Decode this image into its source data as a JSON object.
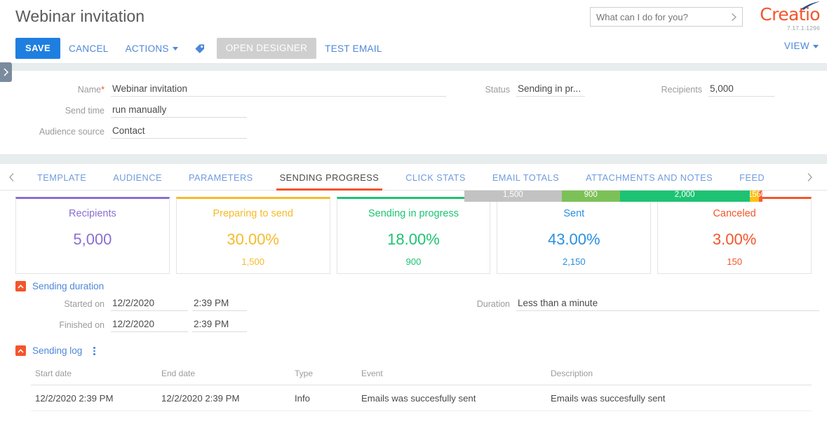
{
  "header": {
    "title": "Webinar invitation",
    "buttons": {
      "save": "SAVE",
      "cancel": "CANCEL",
      "actions": "ACTIONS",
      "tag_icon": "tag-icon",
      "open_designer": "OPEN DESIGNER",
      "test_email": "TEST EMAIL"
    },
    "search": {
      "placeholder": "What can I do for you?",
      "value": ""
    },
    "logo": {
      "name": "Creatio",
      "version": "7.17.1.1296"
    },
    "view": "VIEW"
  },
  "profile": {
    "fields_left": [
      {
        "label": "Name",
        "required": true,
        "value": "Webinar invitation"
      },
      {
        "label": "Send time",
        "required": false,
        "value": "run manually"
      },
      {
        "label": "Audience source",
        "required": false,
        "value": "Contact"
      }
    ],
    "fields_right": [
      {
        "label": "Status",
        "value": "Sending in pr..."
      },
      {
        "label": "Recipients",
        "value": "5,000"
      }
    ]
  },
  "progress_bar": {
    "segments": [
      {
        "label": "1,500",
        "value": 1500,
        "color": "#c2c2c2"
      },
      {
        "label": "900",
        "value": 900,
        "color": "#7cc157"
      },
      {
        "label": "2,000",
        "value": 2000,
        "color": "#1dc373"
      },
      {
        "label": "150",
        "value": 150,
        "color": "#ffc20e"
      },
      {
        "label": "50",
        "value": 50,
        "color": "#fb5a3c"
      }
    ],
    "total": 5000
  },
  "tabs": {
    "items": [
      {
        "label": "TEMPLATE",
        "active": false
      },
      {
        "label": "AUDIENCE",
        "active": false
      },
      {
        "label": "PARAMETERS",
        "active": false
      },
      {
        "label": "SENDING PROGRESS",
        "active": true
      },
      {
        "label": "CLICK STATS",
        "active": false
      },
      {
        "label": "EMAIL TOTALS",
        "active": false
      },
      {
        "label": "ATTACHMENTS AND NOTES",
        "active": false
      },
      {
        "label": "FEED",
        "active": false
      }
    ]
  },
  "cards": [
    {
      "title": "Recipients",
      "main": "5,000",
      "sub": "",
      "color": "#8a6fd1"
    },
    {
      "title": "Preparing to send",
      "main": "30.00%",
      "sub": "1,500",
      "color": "#f5bb2a"
    },
    {
      "title": "Sending in progress",
      "main": "18.00%",
      "sub": "900",
      "color": "#1dc373"
    },
    {
      "title": "Sent",
      "main": "43.00%",
      "sub": "2,150",
      "color": "#2a8fe0"
    },
    {
      "title": "Canceled",
      "main": "3.00%",
      "sub": "150",
      "color": "#f4552b"
    }
  ],
  "sending_duration": {
    "section_title": "Sending duration",
    "started_on": {
      "label": "Started on",
      "date": "12/2/2020",
      "time": "2:39 PM"
    },
    "finished_on": {
      "label": "Finished on",
      "date": "12/2/2020",
      "time": "2:39 PM"
    },
    "duration": {
      "label": "Duration",
      "value": "Less than a minute"
    }
  },
  "sending_log": {
    "section_title": "Sending log",
    "columns": [
      "Start date",
      "End date",
      "Type",
      "Event",
      "Description"
    ],
    "rows": [
      {
        "start_date": "12/2/2020 2:39 PM",
        "end_date": "12/2/2020 2:39 PM",
        "type": "Info",
        "event": "Emails was succesfully sent",
        "description": "Emails was succesfully sent"
      }
    ]
  }
}
